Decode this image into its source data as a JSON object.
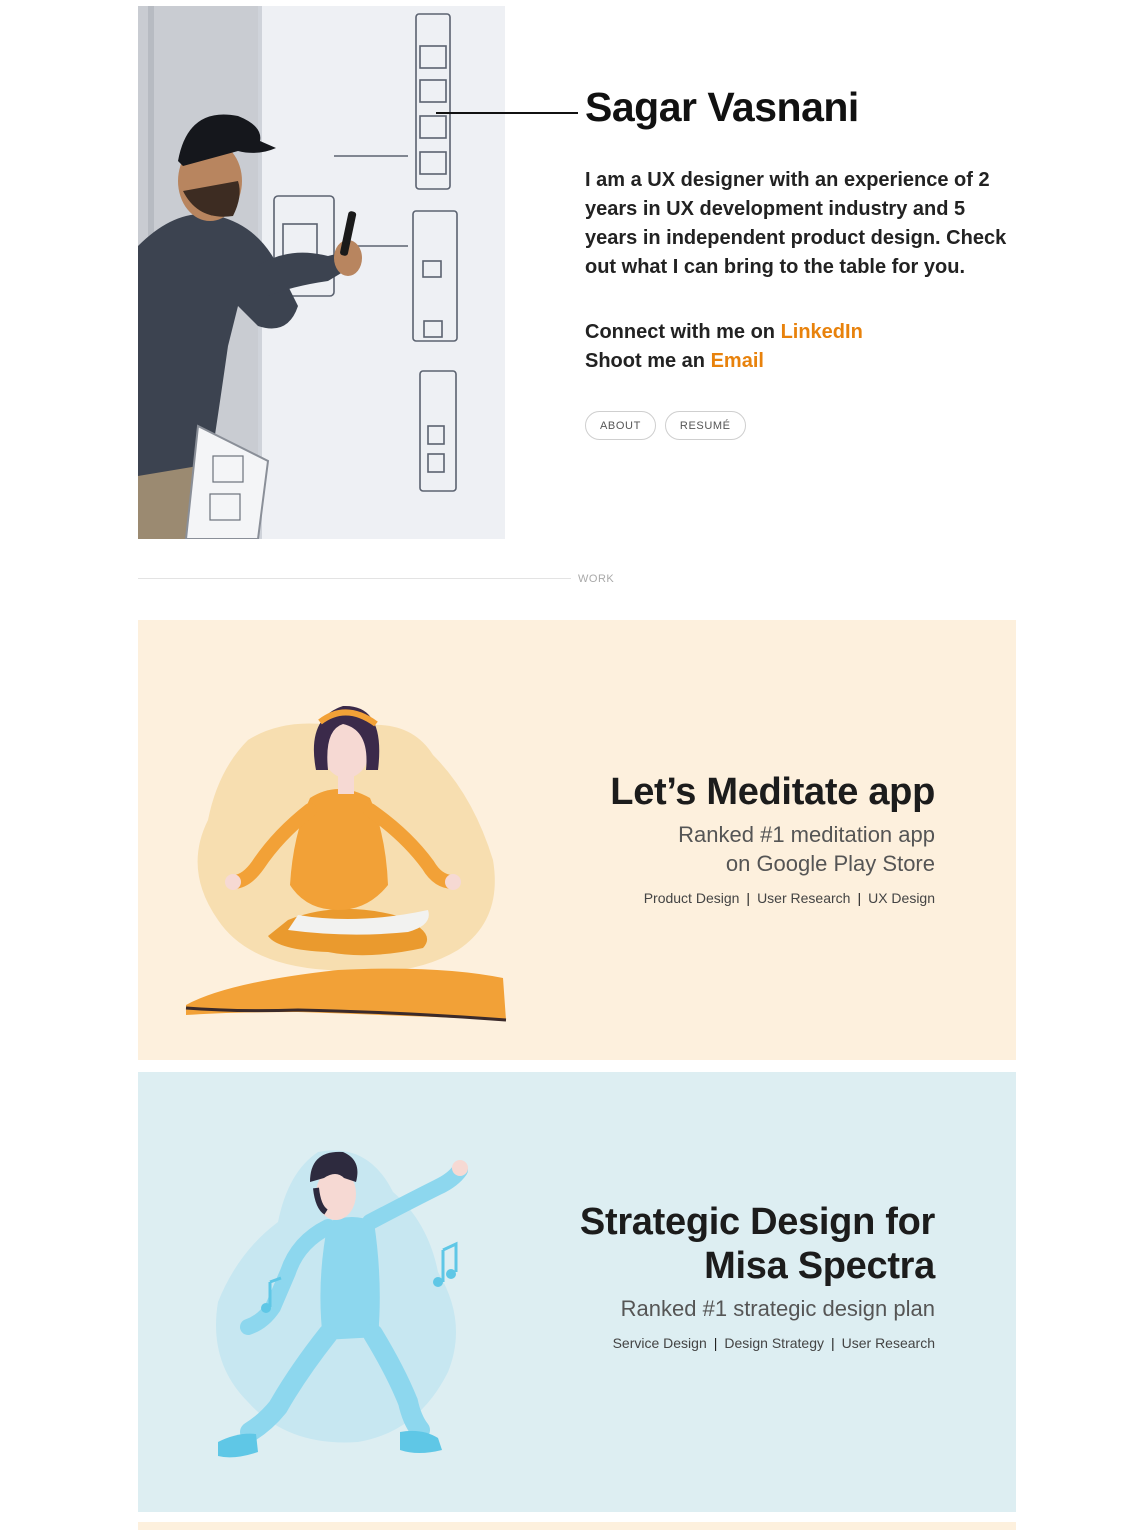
{
  "hero": {
    "name": "Sagar Vasnani",
    "bio": "I am a UX designer with an experience of 2 years in UX development industry and 5 years in independent product design. Check out what I can bring to the table for you.",
    "contact_line1_prefix": "Connect with me on ",
    "contact_line1_link": "LinkedIn",
    "contact_line2_prefix": "Shoot me an ",
    "contact_line2_link": "Email",
    "buttons": {
      "about": "ABOUT",
      "resume": "RESUMÉ"
    },
    "link_color": "#e8820c"
  },
  "section": {
    "label": "WORK"
  },
  "projects": [
    {
      "title": "Let’s Meditate app",
      "subtitle_line1": "Ranked #1 meditation app",
      "subtitle_line2": "on Google Play Store",
      "tags": [
        "Product Design",
        "User Research",
        "UX Design"
      ],
      "bg_color": "#fdf0dd"
    },
    {
      "title_line1": "Strategic Design for",
      "title_line2": "Misa Spectra",
      "subtitle_line1": "Ranked #1 strategic design plan",
      "tags": [
        "Service Design",
        "Design Strategy",
        "User Research"
      ],
      "bg_color": "#ddeef2"
    }
  ],
  "separator": "|",
  "icons": {
    "meditation": "meditation-illustration",
    "music": "music-dancer-illustration",
    "photo": "designer-photo"
  }
}
